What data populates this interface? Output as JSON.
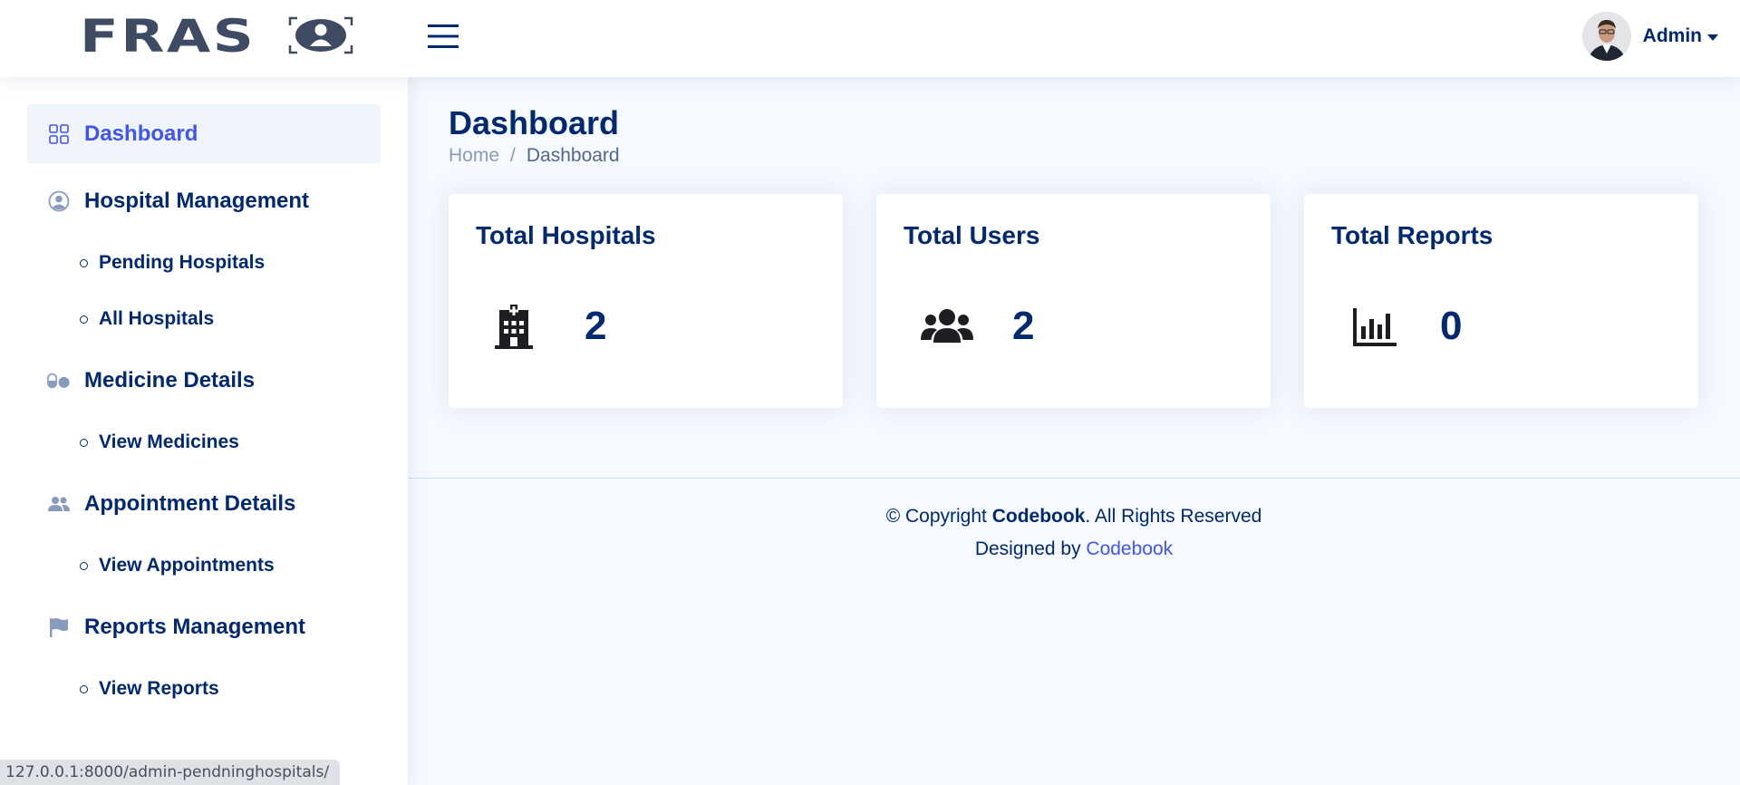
{
  "header": {
    "logo_text": "FRAS",
    "profile_name": "Admin"
  },
  "sidebar": {
    "items": [
      {
        "label": "Dashboard",
        "icon": "grid-icon",
        "active": true
      },
      {
        "label": "Hospital Management",
        "icon": "person-circle-icon"
      },
      {
        "label": "Pending Hospitals",
        "sub": true
      },
      {
        "label": "All Hospitals",
        "sub": true
      },
      {
        "label": "Medicine Details",
        "icon": "capsule-icon"
      },
      {
        "label": "View Medicines",
        "sub": true
      },
      {
        "label": "Appointment Details",
        "icon": "people-icon"
      },
      {
        "label": "View Appointments",
        "sub": true
      },
      {
        "label": "Reports Management",
        "icon": "flag-icon"
      },
      {
        "label": "View Reports",
        "sub": true
      }
    ]
  },
  "main": {
    "title": "Dashboard",
    "breadcrumb": {
      "home": "Home",
      "separator": "/",
      "current": "Dashboard"
    },
    "cards": [
      {
        "title": "Total Hospitals",
        "value": "2",
        "icon": "hospital-icon"
      },
      {
        "title": "Total Users",
        "value": "2",
        "icon": "users-icon"
      },
      {
        "title": "Total Reports",
        "value": "0",
        "icon": "chart-bar-icon"
      }
    ]
  },
  "footer": {
    "copyright_prefix": "© Copyright ",
    "brand": "Codebook",
    "copyright_suffix": ". All Rights Reserved",
    "designed_by": "Designed by ",
    "designer_link": "Codebook"
  },
  "status_bar": {
    "url": "127.0.0.1:8000/admin-pendninghospitals/"
  },
  "colors": {
    "primary": "#012970",
    "accent": "#4154f1",
    "background": "#f6f9ff"
  }
}
